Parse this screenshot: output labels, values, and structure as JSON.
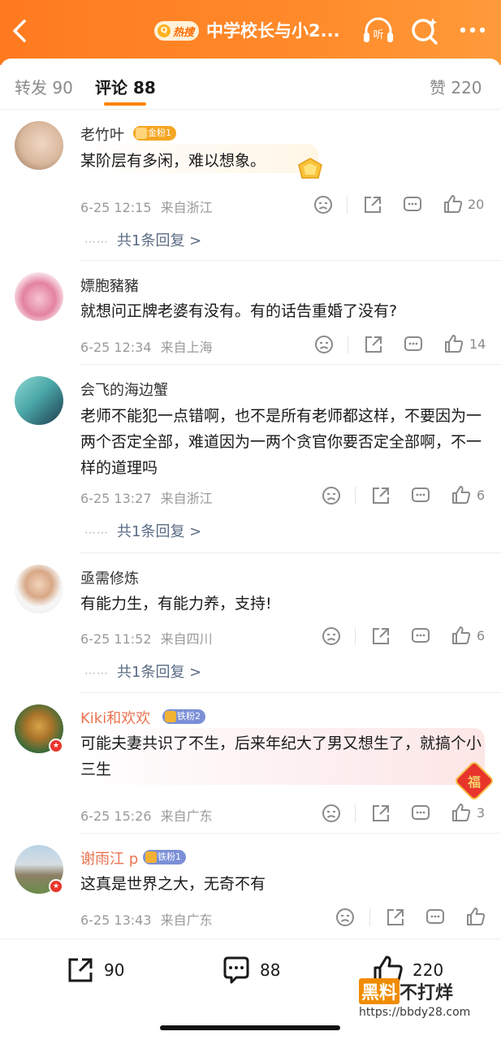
{
  "header": {
    "hot_label": "热搜",
    "hot_glyph": "Q",
    "title": "中学校长与小2...",
    "listen_label": "听"
  },
  "tabs": {
    "repost": "转发 90",
    "comments": "评论 88",
    "likes": "赞 220"
  },
  "comments": [
    {
      "user": "老竹叶",
      "fan_badge": "金粉1",
      "text": "某阶层有多闲，难以想象。",
      "time": "6-25 12:15",
      "location": "来自浙江",
      "likes": "20",
      "replies": "共1条回复 >",
      "reply_dots": "⋯⋯"
    },
    {
      "user": "嫖胞豬豬",
      "text": "就想问正牌老婆有没有。有的话告重婚了没有?",
      "time": "6-25 12:34",
      "location": "来自上海",
      "likes": "14"
    },
    {
      "user": "会飞的海边蟹",
      "text": "老师不能犯一点错啊，也不是所有老师都这样，不要因为一两个否定全部，难道因为一两个贪官你要否定全部啊，不一样的道理吗",
      "time": "6-25 13:27",
      "location": "来自浙江",
      "likes": "6",
      "replies": "共1条回复 >",
      "reply_dots": "⋯⋯"
    },
    {
      "user": "亟需修炼",
      "text": "有能力生，有能力养，支持!",
      "time": "6-25 11:52",
      "location": "来自四川",
      "likes": "6",
      "replies": "共1条回复 >",
      "reply_dots": "⋯⋯"
    },
    {
      "user": "Kiki和欢欢",
      "fan_badge": "铁粉2",
      "text": "可能夫妻共识了不生，后来年纪大了男又想生了，就搞个小三生",
      "time": "6-25 15:26",
      "location": "来自广东",
      "likes": "3",
      "sticker": "福"
    },
    {
      "user": "谢雨江 p",
      "fan_badge": "铁粉1",
      "text": "这真是世界之大，无奇不有",
      "time": "6-25 13:43",
      "location": "来自广东"
    }
  ],
  "bottom_bar": {
    "repost_count": "90",
    "comment_count": "88",
    "like_count": "220"
  },
  "watermark": {
    "box": "黑料",
    "text": "不打烊",
    "url": "https://bbdy28.com"
  },
  "colors": {
    "accent": "#ff8200",
    "header_start": "#ff7a1f",
    "username_vip": "#eb7350",
    "reply_link": "#5a6b84",
    "gold_fan": "#f5a623",
    "iron_fan": "#7b8fd6"
  }
}
